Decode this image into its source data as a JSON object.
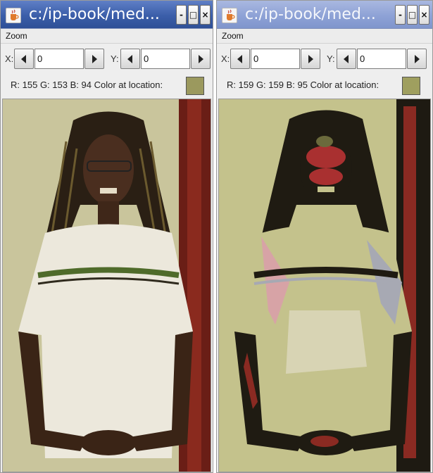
{
  "windows": [
    {
      "title": "c:/ip-book/med...",
      "icon": "java-cup-icon",
      "controls": {
        "minimize": "-",
        "maximize": "□",
        "close": "×"
      },
      "menu": {
        "zoom": "Zoom"
      },
      "coords": {
        "x_label": "X:",
        "x_value": "0",
        "y_label": "Y:",
        "y_value": "0"
      },
      "color_info": {
        "r": "R: 155",
        "g": "G: 153",
        "b": "B: 94",
        "label": "Color at location:",
        "swatch": "#9b995e"
      },
      "photo_kind": "original photograph"
    },
    {
      "title": "c:/ip-book/med...",
      "icon": "java-cup-icon",
      "controls": {
        "minimize": "-",
        "maximize": "□",
        "close": "×"
      },
      "menu": {
        "zoom": "Zoom"
      },
      "coords": {
        "x_label": "X:",
        "x_value": "0",
        "y_label": "Y:",
        "y_value": "0"
      },
      "color_info": {
        "r": "R: 159",
        "g": "G: 159",
        "b": "B: 95",
        "label": "Color at location:",
        "swatch": "#9f9f5f"
      },
      "photo_kind": "posterized photograph"
    }
  ],
  "colors": {
    "titlebar_active": "#3b5ea9",
    "titlebar_inactive": "#8ea2d6",
    "original_wall": "#c9c59c",
    "posterized_wall": "#c4c28c"
  }
}
